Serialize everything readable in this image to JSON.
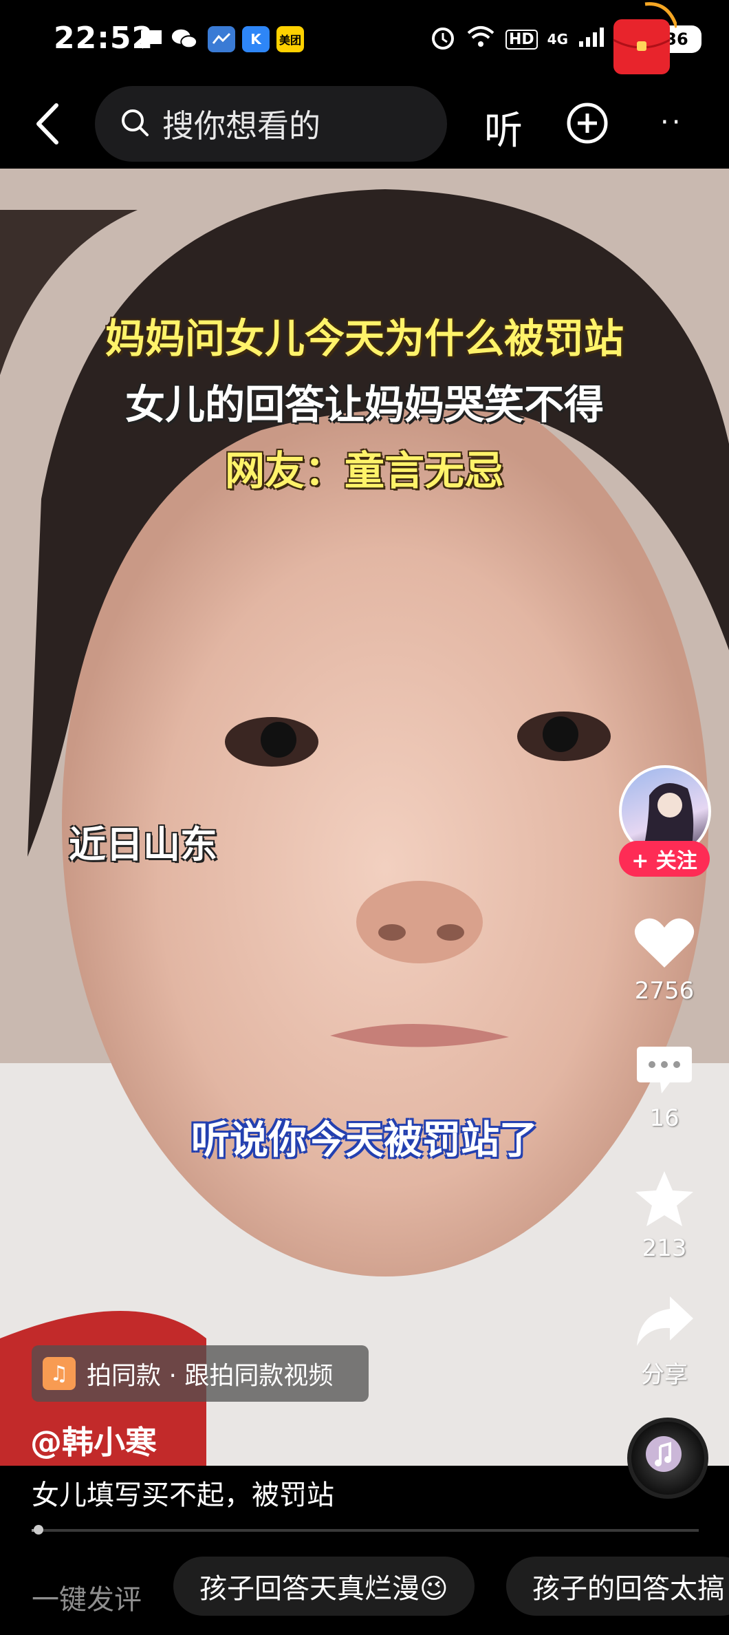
{
  "status_bar": {
    "time": "22:52",
    "notification_icons": [
      "message-icon",
      "wechat-icon",
      "bank-app-icon",
      "k-app-icon",
      "meituan-icon"
    ],
    "meituan_label": "美团",
    "k_label": "K",
    "network_hd": "HD",
    "network_4g": "4G",
    "battery": "36"
  },
  "top_nav": {
    "search_placeholder": "搜你想看的",
    "listen_label": "听"
  },
  "video": {
    "caption_lines": [
      "妈妈问女儿今天为什么被罚站",
      "女儿的回答让妈妈哭笑不得",
      "网友：童言无忌"
    ],
    "location_tag": "近日山东",
    "subtitle": "听说你今天被罚站了"
  },
  "right_rail": {
    "follow_label": "+ 关注",
    "likes": "2756",
    "comments": "16",
    "favorites": "213",
    "share_label": "分享"
  },
  "bottom": {
    "same_style_label": "拍同款 · 跟拍同款视频",
    "author": "@韩小寒",
    "description": "女儿填写买不起，被罚站"
  },
  "playback": {
    "progress_fraction": 0.005
  },
  "comment_bar": {
    "quick_comment_label": "一键发评",
    "chips": [
      "孩子回答天真烂漫😉",
      "孩子的回答太搞"
    ]
  },
  "colors": {
    "accent_red": "#fe2c55",
    "caption_yellow": "#fff36a",
    "subtitle_outline": "#2340b0"
  }
}
